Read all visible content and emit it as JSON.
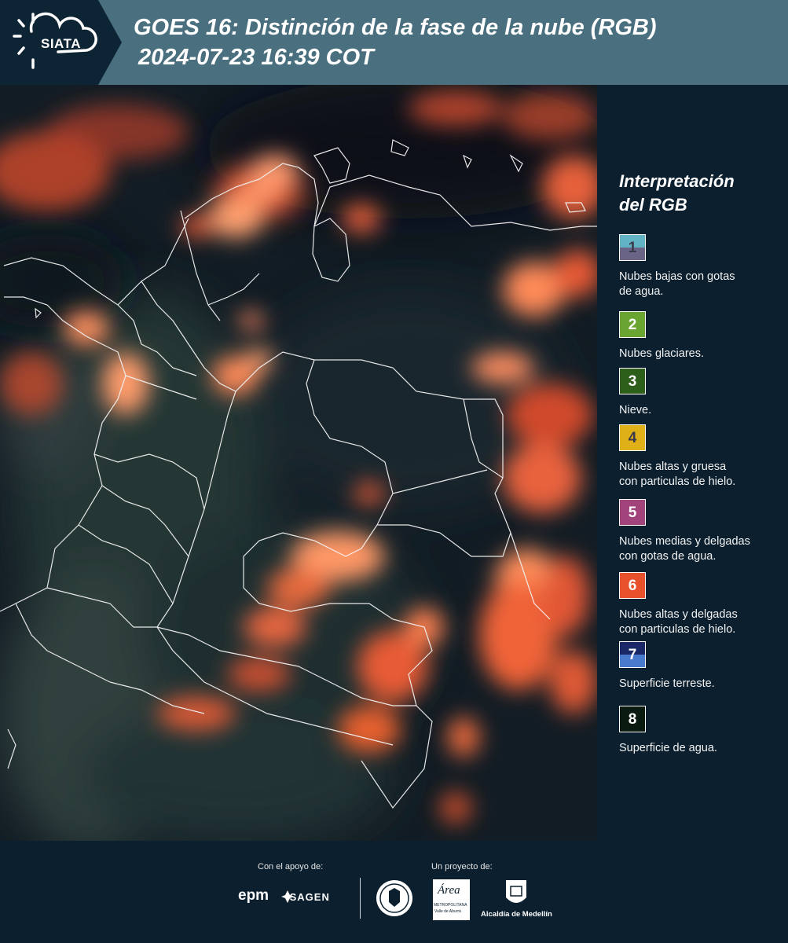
{
  "header": {
    "logo_text": "SIATA",
    "title_line1": "GOES 16: Distinción de la fase de la nube (RGB)",
    "title_line2": "2024-07-23 16:39 COT"
  },
  "legend": {
    "title_line1": "Interpretación",
    "title_line2": "del RGB",
    "items": [
      {
        "num": "1",
        "line1": "Nubes bajas con gotas",
        "line2": "de agua.",
        "color_top": "#62b3c4",
        "color_bottom": "#6a6486"
      },
      {
        "num": "2",
        "line1": "Nubes glaciares.",
        "line2": "",
        "color_top": "#6aa431",
        "color_bottom": "#6aa431"
      },
      {
        "num": "3",
        "line1": "Nieve.",
        "line2": "",
        "color_top": "#2d5e1a",
        "color_bottom": "#2d5e1a"
      },
      {
        "num": "4",
        "line1": "Nubes altas y gruesa",
        "line2": "con particulas de hielo.",
        "color_top": "#e0b018",
        "color_bottom": "#e0b018"
      },
      {
        "num": "5",
        "line1": "Nubes medias y delgadas",
        "line2": "con gotas de agua.",
        "color_top": "#a2437c",
        "color_bottom": "#a2437c"
      },
      {
        "num": "6",
        "line1": "Nubes altas y delgadas",
        "line2": "con particulas de hielo.",
        "color_top": "#e8512c",
        "color_bottom": "#e8512c"
      },
      {
        "num": "7",
        "line1": "Superficie terreste.",
        "line2": "",
        "color_top": "#1a2868",
        "color_bottom": "#4a7acc"
      },
      {
        "num": "8",
        "line1": "Superficie de agua.",
        "line2": "",
        "color_top": "#0b1a10",
        "color_bottom": "#0b1a10"
      }
    ]
  },
  "footer": {
    "support_label": "Con el apoyo de:",
    "project_label": "Un proyecto de:",
    "epm": "epm",
    "isagen": "ISAGEN",
    "area_line1": "Área",
    "area_line2": "METROPOLITANA",
    "area_line3": "Valle de Aburrá",
    "alcaldia": "Alcaldía de Medellín"
  }
}
